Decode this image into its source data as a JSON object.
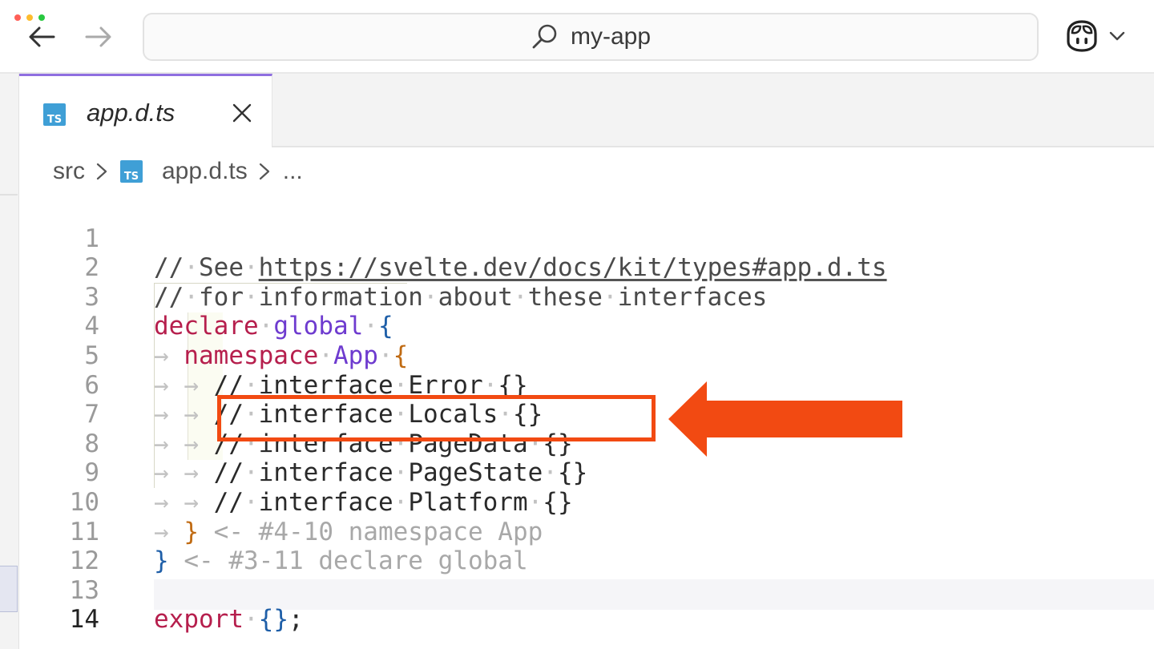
{
  "window": {
    "search_label": "my-app",
    "icons": [
      "back-arrow-icon",
      "forward-arrow-icon",
      "search-icon",
      "copilot-icon",
      "chevron-down-icon"
    ]
  },
  "tab": {
    "label": "app.d.ts",
    "icon": "typescript-file-icon",
    "close_icon": "close-icon"
  },
  "breadcrumb": {
    "items": [
      "src",
      "app.d.ts",
      "..."
    ]
  },
  "editor": {
    "line_numbers": [
      "1",
      "2",
      "3",
      "4",
      "5",
      "6",
      "7",
      "8",
      "9",
      "10",
      "11",
      "12",
      "13",
      "14"
    ],
    "active_line": "14",
    "lines": {
      "l1": {
        "comment_prefix": "//",
        "see": "See",
        "url": "https://svelte.dev/docs/kit/types#app.d.ts"
      },
      "l2": {
        "text": "// for information about these interfaces"
      },
      "l3": {
        "kw": "declare",
        "ty": "global",
        "brace": "{"
      },
      "l4": {
        "kw": "namespace",
        "ty": "App",
        "brace": "{"
      },
      "l5": {
        "text": "// interface Error {}"
      },
      "l6": {
        "text": "// interface Locals {}"
      },
      "l7": {
        "text": "// interface PageData {}"
      },
      "l8": {
        "text": "// interface PageState {}"
      },
      "l9": {
        "text": "// interface Platform {}"
      },
      "l10": {
        "brace": "}",
        "hint": "<- #4-10 namespace App"
      },
      "l11": {
        "brace": "}",
        "hint": "<- #3-11 declare global"
      },
      "l13": {
        "kw": "export",
        "brace": "{}",
        "end": ";"
      }
    }
  },
  "annotation": {
    "color": "#f24a12",
    "highlighted_line": "8"
  },
  "colors": {
    "tab_accent": "#8f6fe0",
    "keyword": "#b61f4d",
    "type": "#6e3bcf",
    "brace_outer": "#1f5fa8",
    "brace_inner": "#c06b13"
  }
}
